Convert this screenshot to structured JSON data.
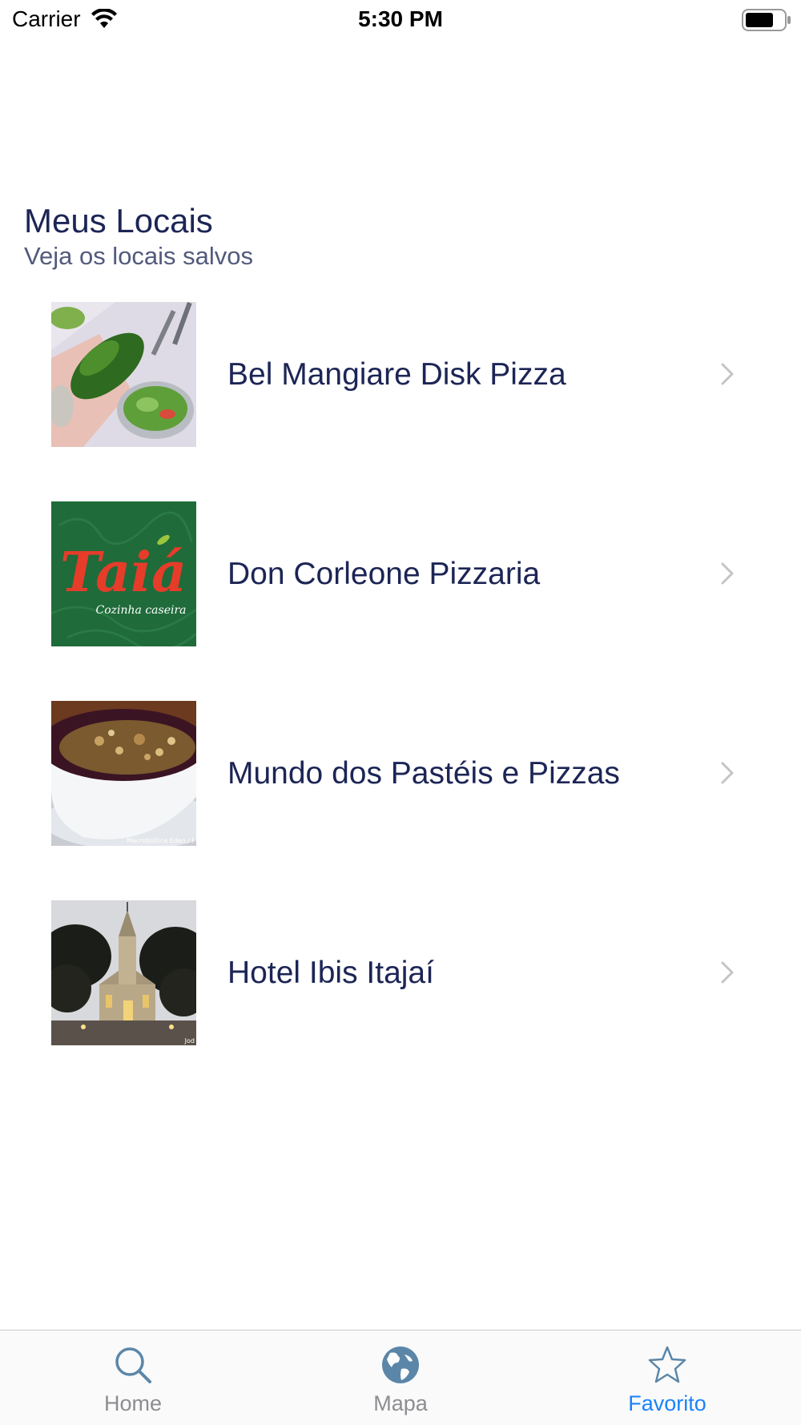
{
  "status_bar": {
    "carrier": "Carrier",
    "time": "5:30 PM"
  },
  "header": {
    "title": "Meus Locais",
    "subtitle": "Veja os locais salvos"
  },
  "places": [
    {
      "name": "Bel Mangiare Disk Pizza",
      "thumbnail": "salad-buffet-photo"
    },
    {
      "name": "Don Corleone Pizzaria",
      "thumbnail": "taia-logo",
      "logo_text": "Taiá",
      "logo_subtext": "Cozinha caseira"
    },
    {
      "name": "Mundo dos Pastéis e Pizzas",
      "thumbnail": "acai-bowl-photo",
      "watermark": "Macrobiótica Eden / I"
    },
    {
      "name": "Hotel Ibis Itajaí",
      "thumbnail": "church-photo",
      "watermark": "Jod"
    }
  ],
  "tab_bar": {
    "tabs": [
      {
        "label": "Home",
        "icon": "search-icon",
        "active": false
      },
      {
        "label": "Mapa",
        "icon": "globe-icon",
        "active": false
      },
      {
        "label": "Favorito",
        "icon": "star-icon",
        "active": true
      }
    ]
  },
  "colors": {
    "text_primary": "#1c2555",
    "text_secondary": "#525a7d",
    "tab_active": "#1a82fb",
    "tab_inactive": "#8d8d92",
    "tab_icon_inactive": "#5b86a8"
  }
}
